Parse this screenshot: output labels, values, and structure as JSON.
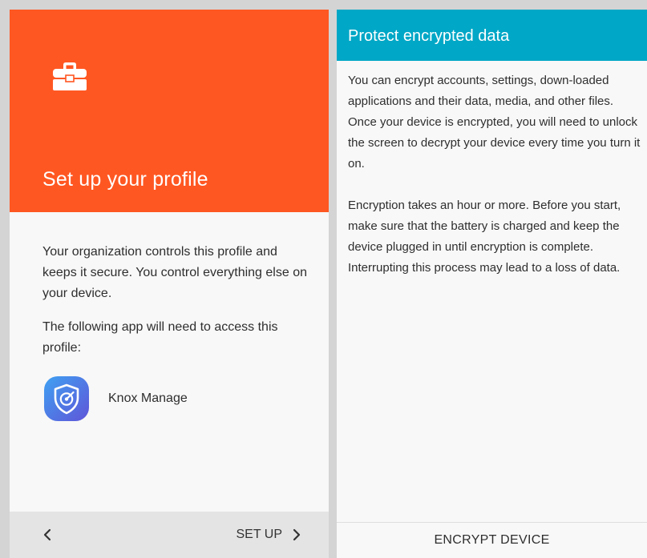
{
  "left_screen": {
    "header": {
      "icon": "briefcase-icon",
      "title": "Set up your profile",
      "color": "#ff5722"
    },
    "body": {
      "paragraph_1": "Your organization controls this profile and keeps it secure. You control everything else on your device.",
      "paragraph_2": "The following app will need to access this profile:"
    },
    "app": {
      "icon": "knox-shield-icon",
      "name": "Knox Manage"
    },
    "footer": {
      "back_icon": "chevron-left-icon",
      "next_label": "SET UP",
      "next_icon": "chevron-right-icon"
    }
  },
  "right_screen": {
    "header": {
      "title": "Protect encrypted data",
      "color": "#00a7c6"
    },
    "body": {
      "paragraph_1": "You can encrypt accounts, settings, down-loaded applications and their data, media, and other files. Once your device is encrypted, you will need to unlock the screen to decrypt your device every time you turn it on.",
      "paragraph_2": "Encryption takes an hour or more. Before you start, make sure that the battery is charged and keep the device plugged in until encryption is complete. Interrupting this process may lead to a loss of data."
    },
    "footer": {
      "button_label": "ENCRYPT DEVICE"
    }
  }
}
